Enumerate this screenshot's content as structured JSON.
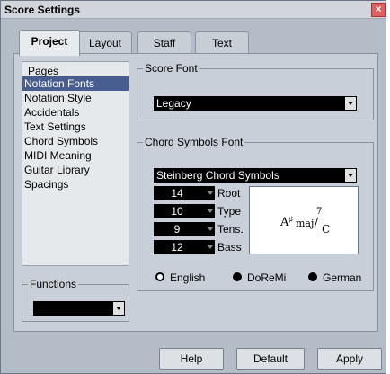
{
  "window": {
    "title": "Score Settings"
  },
  "tabs": [
    {
      "label": "Project"
    },
    {
      "label": "Layout"
    },
    {
      "label": "Staff"
    },
    {
      "label": "Text"
    }
  ],
  "pages": {
    "heading": "Pages",
    "items": [
      {
        "label": "Notation Fonts",
        "selected": true
      },
      {
        "label": "Notation Style"
      },
      {
        "label": "Accidentals"
      },
      {
        "label": "Text Settings"
      },
      {
        "label": "Chord Symbols"
      },
      {
        "label": "MIDI Meaning"
      },
      {
        "label": "Guitar Library"
      },
      {
        "label": "Spacings"
      }
    ]
  },
  "functions": {
    "label": "Functions",
    "value": ""
  },
  "score_font": {
    "label": "Score Font",
    "value": "Legacy"
  },
  "chord_font": {
    "label": "Chord Symbols Font",
    "value": "Steinberg Chord Symbols",
    "sizes": [
      {
        "value": "14",
        "label": "Root"
      },
      {
        "value": "10",
        "label": "Type"
      },
      {
        "value": "9",
        "label": "Tens."
      },
      {
        "value": "12",
        "label": "Bass"
      }
    ],
    "preview": {
      "root": "A",
      "accidental": "♯",
      "type": "maj",
      "tension": "7",
      "bass": "C"
    }
  },
  "notation": {
    "options": [
      {
        "label": "English",
        "selected": true
      },
      {
        "label": "DoReMi"
      },
      {
        "label": "German"
      }
    ]
  },
  "buttons": {
    "help": "Help",
    "default": "Default",
    "apply": "Apply"
  },
  "colors": {
    "selection": "#485e90",
    "background": "#b4bcc8",
    "panel": "#c8cfd8"
  }
}
